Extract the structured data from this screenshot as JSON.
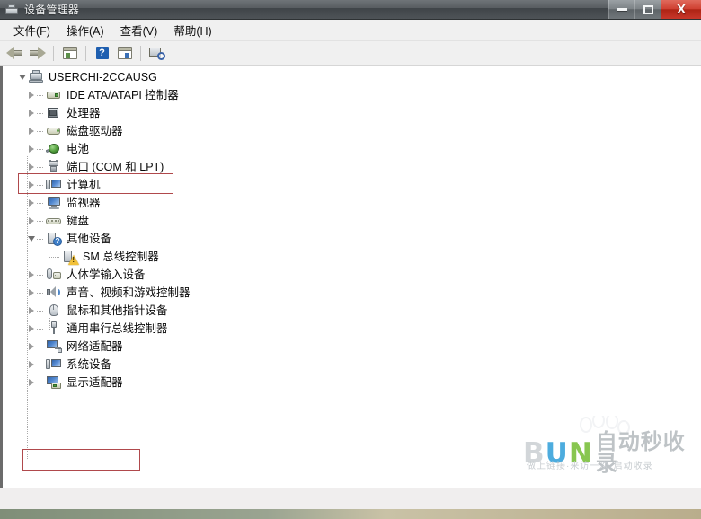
{
  "window": {
    "title": "设备管理器",
    "icon": "device-manager-icon",
    "controls": {
      "minimize": "—",
      "maximize": "□",
      "close": "X"
    }
  },
  "menubar": {
    "items": [
      {
        "label": "文件(F)",
        "name": "menu-file"
      },
      {
        "label": "操作(A)",
        "name": "menu-action"
      },
      {
        "label": "查看(V)",
        "name": "menu-view"
      },
      {
        "label": "帮助(H)",
        "name": "menu-help"
      }
    ]
  },
  "toolbar": {
    "buttons": [
      {
        "name": "back-button",
        "icon": "back-arrow-icon",
        "label": ""
      },
      {
        "name": "forward-button",
        "icon": "forward-arrow-icon",
        "label": ""
      },
      {
        "name": "properties-button",
        "icon": "properties-panel-icon",
        "label": ""
      },
      {
        "name": "help-button",
        "icon": "help-question-icon",
        "label": "?"
      },
      {
        "name": "show-hidden-button",
        "icon": "panel-right-icon",
        "label": ""
      },
      {
        "name": "scan-hardware-button",
        "icon": "scan-monitor-icon",
        "label": ""
      }
    ]
  },
  "tree": {
    "root": {
      "label": "USERCHI-2CCAUSG",
      "icon": "computer-root-icon",
      "expanded": true
    },
    "nodes": [
      {
        "label": "IDE ATA/ATAPI 控制器",
        "icon": "ide-controller-icon",
        "state": "collapsed",
        "level": 1,
        "highlighted": false
      },
      {
        "label": "处理器",
        "icon": "processor-icon",
        "state": "collapsed",
        "level": 1,
        "highlighted": true
      },
      {
        "label": "磁盘驱动器",
        "icon": "disk-drive-icon",
        "state": "collapsed",
        "level": 1,
        "highlighted": false
      },
      {
        "label": "电池",
        "icon": "battery-icon",
        "state": "collapsed",
        "level": 1,
        "highlighted": false
      },
      {
        "label": "端口 (COM 和 LPT)",
        "icon": "port-icon",
        "state": "collapsed",
        "level": 1,
        "highlighted": false
      },
      {
        "label": "计算机",
        "icon": "computer-icon",
        "state": "collapsed",
        "level": 1,
        "highlighted": false
      },
      {
        "label": "监视器",
        "icon": "monitor-icon",
        "state": "collapsed",
        "level": 1,
        "highlighted": false
      },
      {
        "label": "键盘",
        "icon": "keyboard-icon",
        "state": "collapsed",
        "level": 1,
        "highlighted": false
      },
      {
        "label": "其他设备",
        "icon": "other-devices-icon",
        "state": "expanded",
        "level": 1,
        "highlighted": false
      },
      {
        "label": "SM 总线控制器",
        "icon": "warning-device-icon",
        "state": "leaf",
        "level": 2,
        "highlighted": false
      },
      {
        "label": "人体学输入设备",
        "icon": "hid-icon",
        "state": "collapsed",
        "level": 1,
        "highlighted": false
      },
      {
        "label": "声音、视频和游戏控制器",
        "icon": "sound-video-icon",
        "state": "collapsed",
        "level": 1,
        "highlighted": false
      },
      {
        "label": "鼠标和其他指针设备",
        "icon": "mouse-icon",
        "state": "collapsed",
        "level": 1,
        "highlighted": false
      },
      {
        "label": "通用串行总线控制器",
        "icon": "usb-controller-icon",
        "state": "collapsed",
        "level": 1,
        "highlighted": false
      },
      {
        "label": "网络适配器",
        "icon": "network-adapter-icon",
        "state": "collapsed",
        "level": 1,
        "highlighted": false
      },
      {
        "label": "系统设备",
        "icon": "system-device-icon",
        "state": "collapsed",
        "level": 1,
        "highlighted": false
      },
      {
        "label": "显示适配器",
        "icon": "display-adapter-icon",
        "state": "collapsed",
        "level": 1,
        "highlighted": true
      }
    ],
    "highlight_color": "#b0494c"
  },
  "watermark": {
    "logo_b": "B",
    "logo_u": "U",
    "logo_n": "N",
    "logo_cn": "自动秒收录",
    "tagline": "做上链接·来访一次·启动收录"
  },
  "statusbar": {
    "text": ""
  }
}
